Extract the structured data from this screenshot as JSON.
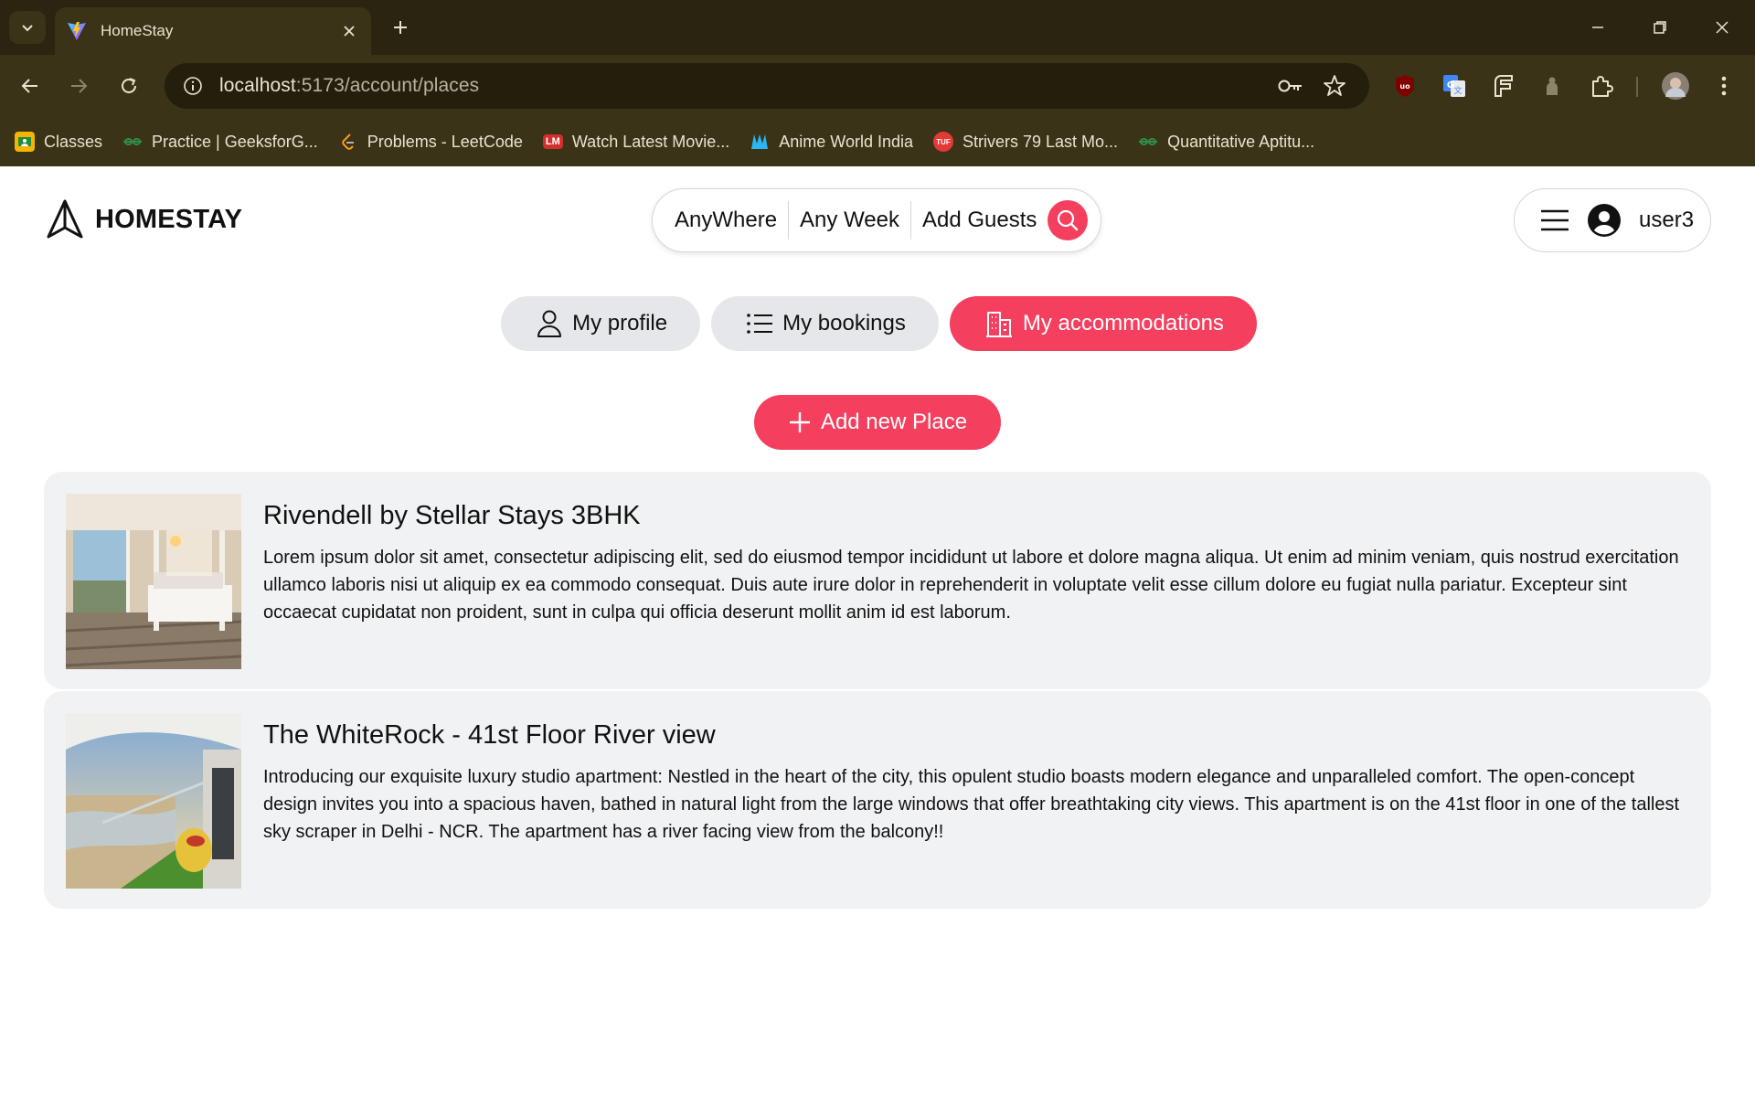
{
  "browser": {
    "tab_title": "HomeStay",
    "url_host": "localhost",
    "url_rest": ":5173/account/places",
    "bookmarks": [
      {
        "label": "Classes",
        "icon": "classroom-icon",
        "color": "#f4b400"
      },
      {
        "label": "Practice | GeeksforG...",
        "icon": "geeksforgeeks-icon",
        "color": "#2f8d46"
      },
      {
        "label": "Problems - LeetCode",
        "icon": "leetcode-icon",
        "color": "#ffa116"
      },
      {
        "label": "Watch Latest Movie...",
        "icon": "movie-site-icon",
        "color": "#d32f2f"
      },
      {
        "label": "Anime World India",
        "icon": "anime-icon",
        "color": "#29b6f6"
      },
      {
        "label": "Strivers 79 Last Mo...",
        "icon": "tuf-icon",
        "color": "#e53935"
      },
      {
        "label": "Quantitative Aptitu...",
        "icon": "geeksforgeeks-icon",
        "color": "#2f8d46"
      }
    ]
  },
  "header": {
    "brand": "HOMESTAY",
    "search": {
      "where": "AnyWhere",
      "when": "Any Week",
      "guests": "Add Guests"
    },
    "username": "user3"
  },
  "account_tabs": [
    {
      "label": "My profile",
      "icon": "user-icon",
      "active": false
    },
    {
      "label": "My bookings",
      "icon": "list-icon",
      "active": false
    },
    {
      "label": "My accommodations",
      "icon": "building-icon",
      "active": true
    }
  ],
  "add_place_label": "Add new Place",
  "places": [
    {
      "title": "Rivendell by Stellar Stays 3BHK",
      "description": "Lorem ipsum dolor sit amet, consectetur adipiscing elit, sed do eiusmod tempor incididunt ut labore et dolore magna aliqua. Ut enim ad minim veniam, quis nostrud exercitation ullamco laboris nisi ut aliquip ex ea commodo consequat. Duis aute irure dolor in reprehenderit in voluptate velit esse cillum dolore eu fugiat nulla pariatur. Excepteur sint occaecat cupidatat non proident, sunt in culpa qui officia deserunt mollit anim id est laborum."
    },
    {
      "title": "The WhiteRock - 41st Floor River view",
      "description": "Introducing our exquisite luxury studio apartment: Nestled in the heart of the city, this opulent studio boasts modern elegance and unparalleled comfort. The open-concept design invites you into a spacious haven, bathed in natural light from the large windows that offer breathtaking city views. This apartment is on the 41st floor in one of the tallest sky scraper in Delhi - NCR. The apartment has a river facing view from the balcony!!"
    }
  ],
  "colors": {
    "accent": "#f43f5e",
    "chrome": "#3a3318",
    "card": "#f1f2f4"
  }
}
